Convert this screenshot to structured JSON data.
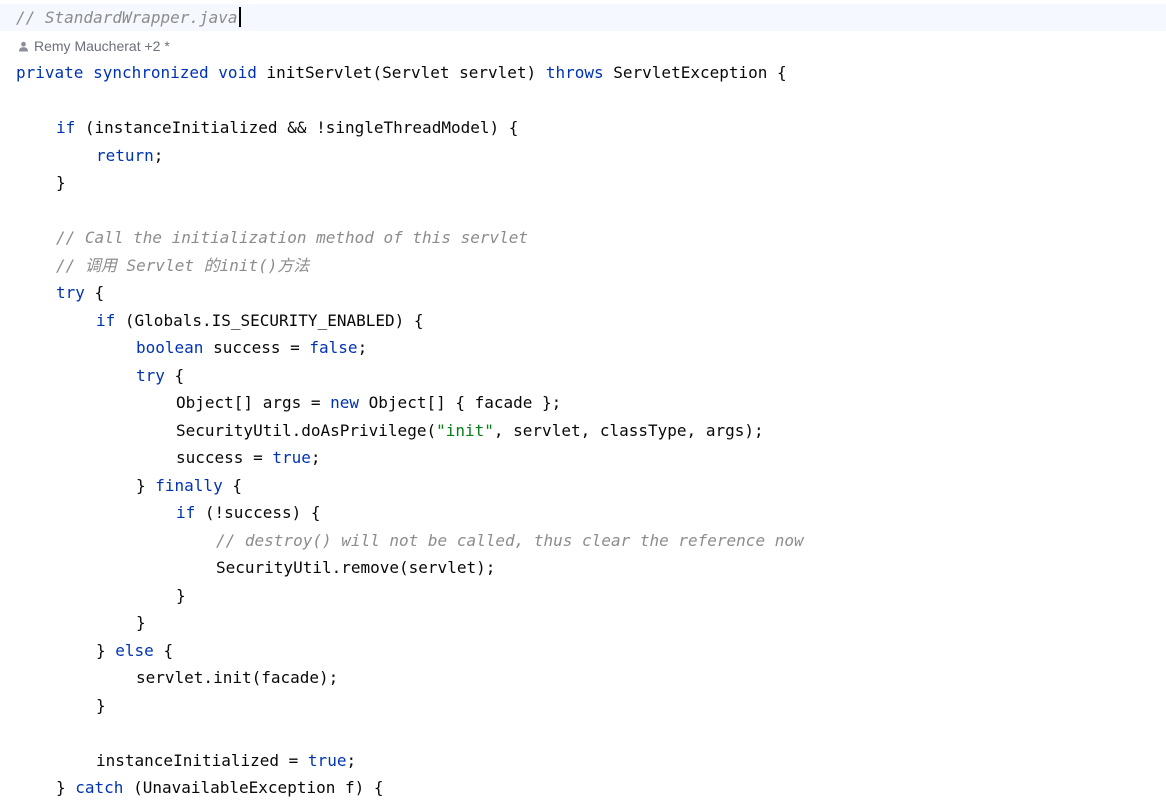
{
  "editor": {
    "file_comment": "// StandardWrapper.java",
    "author_hint": "Remy Maucherat +2 *",
    "lines": [
      {
        "indent": 0,
        "tokens": [
          {
            "t": "private ",
            "c": "kw"
          },
          {
            "t": "synchronized ",
            "c": "kw"
          },
          {
            "t": "void ",
            "c": "kw"
          },
          {
            "t": "initServlet(Servlet servlet) ",
            "c": "txt"
          },
          {
            "t": "throws ",
            "c": "kw"
          },
          {
            "t": "ServletException {",
            "c": "txt"
          }
        ]
      },
      {
        "indent": 0,
        "tokens": []
      },
      {
        "indent": 1,
        "tokens": [
          {
            "t": "if ",
            "c": "kw"
          },
          {
            "t": "(instanceInitialized && !singleThreadModel) {",
            "c": "txt"
          }
        ]
      },
      {
        "indent": 2,
        "tokens": [
          {
            "t": "return",
            "c": "kw"
          },
          {
            "t": ";",
            "c": "txt"
          }
        ]
      },
      {
        "indent": 1,
        "tokens": [
          {
            "t": "}",
            "c": "txt"
          }
        ]
      },
      {
        "indent": 0,
        "tokens": []
      },
      {
        "indent": 1,
        "tokens": [
          {
            "t": "// Call the initialization method of this servlet",
            "c": "cm"
          }
        ]
      },
      {
        "indent": 1,
        "tokens": [
          {
            "t": "// 调用 Servlet 的init()方法",
            "c": "cm"
          }
        ]
      },
      {
        "indent": 1,
        "tokens": [
          {
            "t": "try ",
            "c": "kw"
          },
          {
            "t": "{",
            "c": "txt"
          }
        ]
      },
      {
        "indent": 2,
        "tokens": [
          {
            "t": "if ",
            "c": "kw"
          },
          {
            "t": "(Globals.IS_SECURITY_ENABLED) {",
            "c": "txt"
          }
        ]
      },
      {
        "indent": 3,
        "tokens": [
          {
            "t": "boolean ",
            "c": "kw"
          },
          {
            "t": "success = ",
            "c": "txt"
          },
          {
            "t": "false",
            "c": "kw"
          },
          {
            "t": ";",
            "c": "txt"
          }
        ]
      },
      {
        "indent": 3,
        "tokens": [
          {
            "t": "try ",
            "c": "kw"
          },
          {
            "t": "{",
            "c": "txt"
          }
        ]
      },
      {
        "indent": 4,
        "tokens": [
          {
            "t": "Object[] args = ",
            "c": "txt"
          },
          {
            "t": "new ",
            "c": "kw"
          },
          {
            "t": "Object[] { facade };",
            "c": "txt"
          }
        ]
      },
      {
        "indent": 4,
        "tokens": [
          {
            "t": "SecurityUtil.doAsPrivilege(",
            "c": "txt"
          },
          {
            "t": "\"init\"",
            "c": "str"
          },
          {
            "t": ", servlet, classType, args);",
            "c": "txt"
          }
        ]
      },
      {
        "indent": 4,
        "tokens": [
          {
            "t": "success = ",
            "c": "txt"
          },
          {
            "t": "true",
            "c": "kw"
          },
          {
            "t": ";",
            "c": "txt"
          }
        ]
      },
      {
        "indent": 3,
        "tokens": [
          {
            "t": "} ",
            "c": "txt"
          },
          {
            "t": "finally ",
            "c": "kw"
          },
          {
            "t": "{",
            "c": "txt"
          }
        ]
      },
      {
        "indent": 4,
        "tokens": [
          {
            "t": "if ",
            "c": "kw"
          },
          {
            "t": "(!success) {",
            "c": "txt"
          }
        ]
      },
      {
        "indent": 5,
        "tokens": [
          {
            "t": "// destroy() will not be called, thus clear the reference now",
            "c": "cm"
          }
        ]
      },
      {
        "indent": 5,
        "tokens": [
          {
            "t": "SecurityUtil.remove(servlet);",
            "c": "txt"
          }
        ]
      },
      {
        "indent": 4,
        "tokens": [
          {
            "t": "}",
            "c": "txt"
          }
        ]
      },
      {
        "indent": 3,
        "tokens": [
          {
            "t": "}",
            "c": "txt"
          }
        ]
      },
      {
        "indent": 2,
        "tokens": [
          {
            "t": "} ",
            "c": "txt"
          },
          {
            "t": "else ",
            "c": "kw"
          },
          {
            "t": "{",
            "c": "txt"
          }
        ]
      },
      {
        "indent": 3,
        "tokens": [
          {
            "t": "servlet.init(facade);",
            "c": "txt"
          }
        ]
      },
      {
        "indent": 2,
        "tokens": [
          {
            "t": "}",
            "c": "txt"
          }
        ]
      },
      {
        "indent": 0,
        "tokens": []
      },
      {
        "indent": 2,
        "tokens": [
          {
            "t": "instanceInitialized = ",
            "c": "txt"
          },
          {
            "t": "true",
            "c": "kw"
          },
          {
            "t": ";",
            "c": "txt"
          }
        ]
      },
      {
        "indent": 1,
        "tokens": [
          {
            "t": "} ",
            "c": "txt"
          },
          {
            "t": "catch ",
            "c": "kw"
          },
          {
            "t": "(UnavailableException f) {",
            "c": "txt"
          }
        ]
      }
    ]
  },
  "colors": {
    "keyword": "#0033b3",
    "comment": "#8c8c8c",
    "string": "#067d17",
    "text": "#080808",
    "author": "#6c707e",
    "current_line": "#f5f8fe"
  }
}
